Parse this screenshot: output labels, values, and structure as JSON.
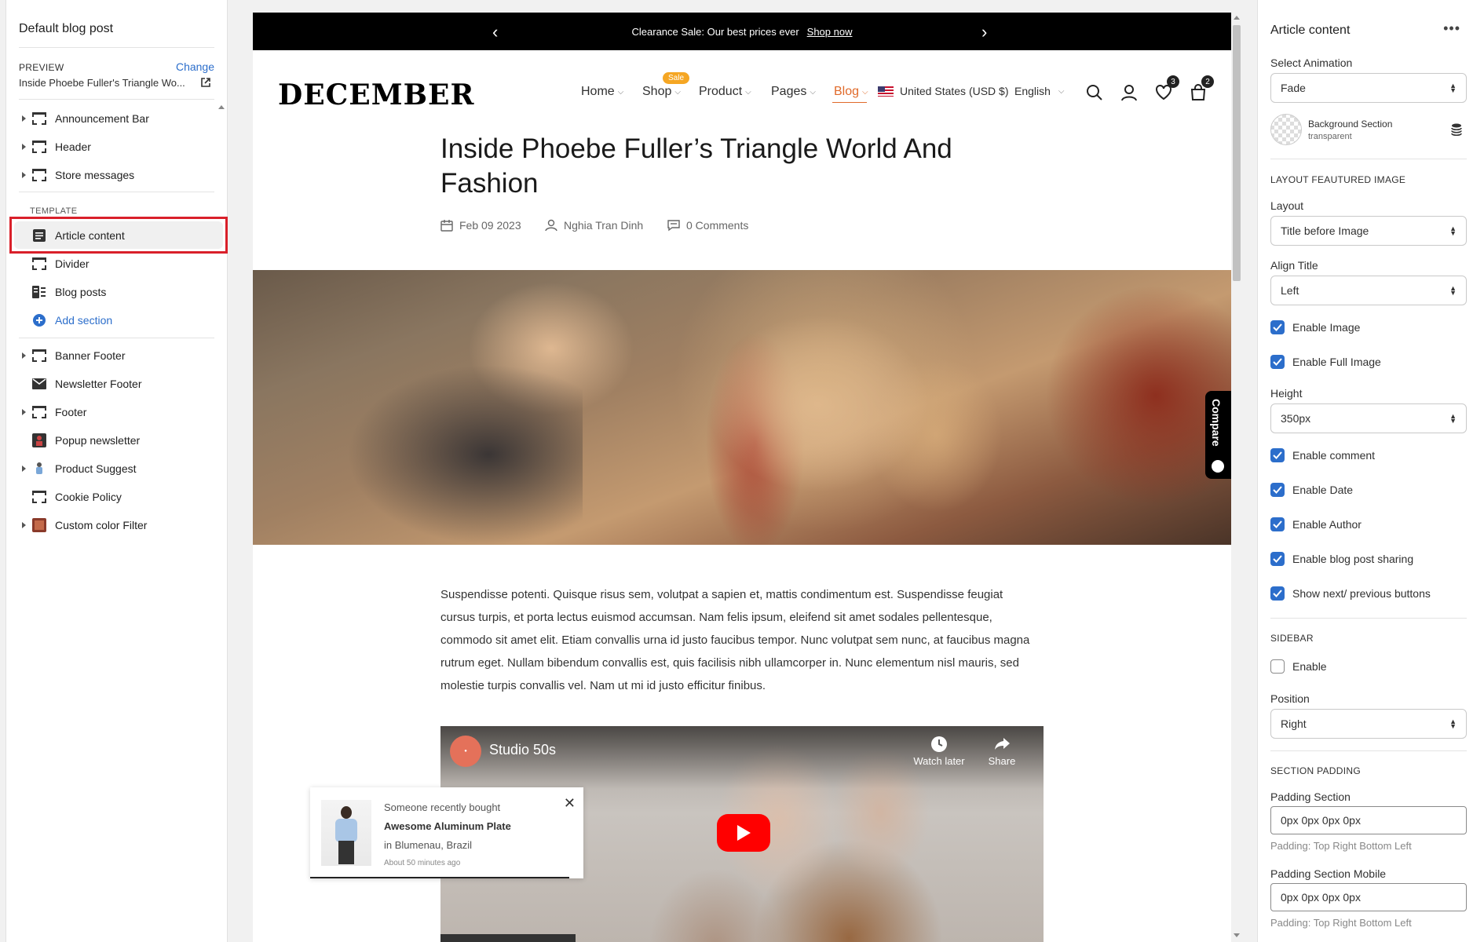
{
  "left": {
    "title": "Default blog post",
    "preview_label": "PREVIEW",
    "change_label": "Change",
    "preview_page": "Inside Phoebe Fuller's Triangle Wo...",
    "header_items": [
      {
        "label": "Announcement Bar"
      },
      {
        "label": "Header"
      },
      {
        "label": "Store messages"
      }
    ],
    "template_label": "TEMPLATE",
    "template_items": [
      {
        "label": "Article content"
      },
      {
        "label": "Divider"
      },
      {
        "label": "Blog posts"
      }
    ],
    "add_section": "Add section",
    "footer_items": [
      {
        "label": "Banner Footer"
      },
      {
        "label": "Newsletter Footer"
      },
      {
        "label": "Footer"
      },
      {
        "label": "Popup newsletter"
      },
      {
        "label": "Product Suggest"
      },
      {
        "label": "Cookie Policy"
      },
      {
        "label": "Custom color Filter"
      }
    ]
  },
  "preview": {
    "announcement": {
      "text": "Clearance Sale: Our best prices ever",
      "link": "Shop now"
    },
    "logo": "DECEMBER",
    "nav": [
      {
        "label": "Home"
      },
      {
        "label": "Shop"
      },
      {
        "label": "Product"
      },
      {
        "label": "Pages"
      },
      {
        "label": "Blog"
      }
    ],
    "sale_badge": "Sale",
    "currency": "United States (USD $)",
    "language": "English",
    "wishlist_count": "3",
    "cart_count": "2",
    "post_title": "Inside Phoebe Fuller’s Triangle World And Fashion",
    "date": "Feb 09 2023",
    "author": "Nghia Tran Dinh",
    "comments": "0 Comments",
    "compare": "Compare",
    "body": "Suspendisse potenti. Quisque risus sem, volutpat a sapien et, mattis condimentum est. Suspendisse feugiat cursus turpis, et porta lectus euismod accumsan. Nam felis ipsum, eleifend sit amet sodales pellentesque, commodo sit amet elit. Etiam convallis urna id justo faucibus tempor. Nunc volutpat sem nunc, at faucibus magna rutrum eget. Nullam bibendum convallis est, quis facilisis nibh ullamcorper in. Nunc elementum nisl mauris, sed molestie turpis convallis vel. Nam ut mi id justo efficitur finibus.",
    "video": {
      "channel": "Studio 50s",
      "watch_later": "Watch later",
      "share": "Share"
    },
    "popup": {
      "line1": "Someone recently bought",
      "product": "Awesome Aluminum Plate",
      "location": "in Blumenau, Brazil",
      "time": "About 50 minutes ago"
    }
  },
  "right": {
    "title": "Article content",
    "select_animation_label": "Select Animation",
    "animation": "Fade",
    "bg_section_label": "Background Section",
    "bg_section_value": "transparent",
    "layout_head": "LAYOUT FEAUTURED IMAGE",
    "layout_label": "Layout",
    "layout_value": "Title before Image",
    "align_label": "Align Title",
    "align_value": "Left",
    "enable_image": "Enable Image",
    "enable_full_image": "Enable Full Image",
    "height_label": "Height",
    "height_value": "350px",
    "enable_comment": "Enable comment",
    "enable_date": "Enable Date",
    "enable_author": "Enable Author",
    "enable_sharing": "Enable blog post sharing",
    "show_nextprev": "Show next/ previous buttons",
    "sidebar_head": "SIDEBAR",
    "sidebar_enable": "Enable",
    "position_label": "Position",
    "position_value": "Right",
    "padding_head": "SECTION PADDING",
    "padding_label": "Padding Section",
    "padding_value": "0px 0px 0px 0px",
    "padding_help": "Padding: Top Right Bottom Left",
    "padding_mobile_label": "Padding Section Mobile",
    "padding_mobile_value": "0px 0px 0px 0px",
    "padding_mobile_help": "Padding: Top Right Bottom Left"
  },
  "colors": {
    "accent": "#2c6ecb",
    "highlight": "#d9202a",
    "sale": "#f5a623",
    "blog_active": "#e06a2a"
  }
}
